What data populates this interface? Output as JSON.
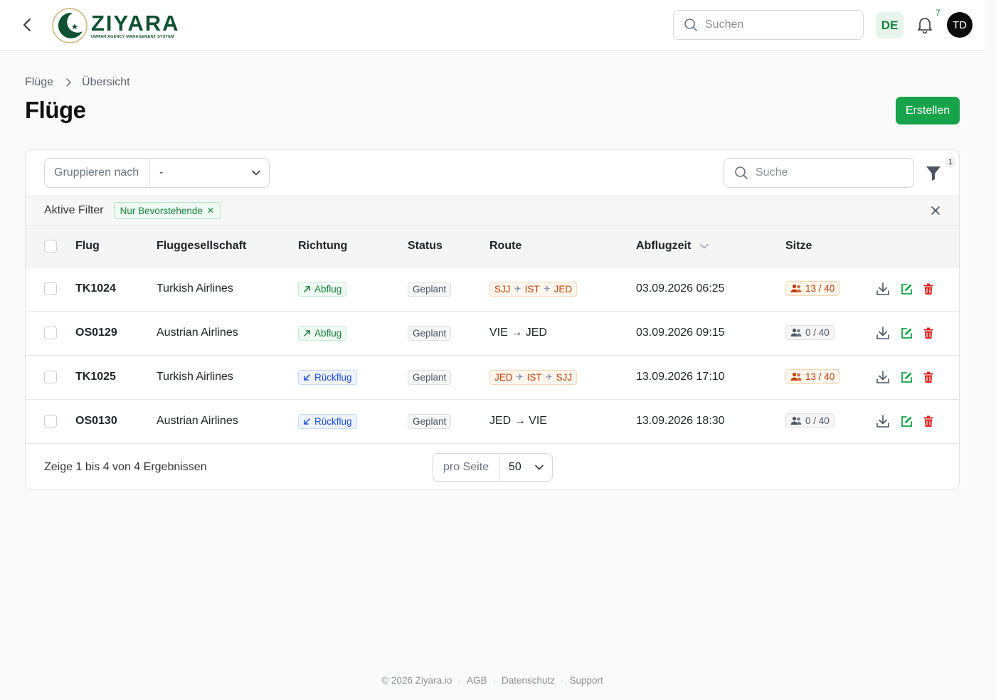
{
  "header": {
    "logo_name": "ZIYARA",
    "logo_subtitle": "UMRAH AGENCY MANAGEMENT SYSTEM",
    "search_placeholder": "Suchen",
    "language": "DE",
    "notification_count": "7",
    "user_initials": "TD"
  },
  "breadcrumb": [
    "Flüge",
    "Übersicht"
  ],
  "page_title": "Flüge",
  "create_button": "Erstellen",
  "toolbar": {
    "group_label": "Gruppieren nach",
    "group_value": "-",
    "search_placeholder": "Suche",
    "filter_count": "1"
  },
  "active_filters": {
    "label": "Aktive Filter",
    "chips": [
      "Nur Bevorstehende"
    ]
  },
  "table": {
    "columns": {
      "flight": "Flug",
      "airline": "Fluggesellschaft",
      "direction": "Richtung",
      "status": "Status",
      "route": "Route",
      "departure": "Abflugzeit",
      "seats": "Sitze"
    },
    "rows": [
      {
        "flight": "TK1024",
        "airline": "Turkish Airlines",
        "direction": "Abflug",
        "direction_type": "departure",
        "status": "Geplant",
        "route": [
          "SJJ",
          "IST",
          "JED"
        ],
        "route_type": "stopover",
        "departure": "03.09.2026 06:25",
        "seats": "13 / 40",
        "seats_type": "booked"
      },
      {
        "flight": "OS0129",
        "airline": "Austrian Airlines",
        "direction": "Abflug",
        "direction_type": "departure",
        "status": "Geplant",
        "route": [
          "VIE",
          "JED"
        ],
        "route_type": "direct",
        "departure": "03.09.2026 09:15",
        "seats": "0 / 40",
        "seats_type": "empty"
      },
      {
        "flight": "TK1025",
        "airline": "Turkish Airlines",
        "direction": "Rückflug",
        "direction_type": "return",
        "status": "Geplant",
        "route": [
          "JED",
          "IST",
          "SJJ"
        ],
        "route_type": "stopover",
        "departure": "13.09.2026 17:10",
        "seats": "13 / 40",
        "seats_type": "booked"
      },
      {
        "flight": "OS0130",
        "airline": "Austrian Airlines",
        "direction": "Rückflug",
        "direction_type": "return",
        "status": "Geplant",
        "route": [
          "JED",
          "VIE"
        ],
        "route_type": "direct",
        "departure": "13.09.2026 18:30",
        "seats": "0 / 40",
        "seats_type": "empty"
      }
    ]
  },
  "pagination": {
    "summary": "Zeige 1 bis 4 von 4 Ergebnissen",
    "per_page_label": "pro Seite",
    "per_page_value": "50"
  },
  "footer": {
    "copyright": "© 2026 Ziyara.io",
    "links": [
      "AGB",
      "Datenschutz",
      "Support"
    ]
  },
  "colors": {
    "brand": "#0f5132",
    "accent": "#16a34a",
    "delete": "#dc2626"
  }
}
